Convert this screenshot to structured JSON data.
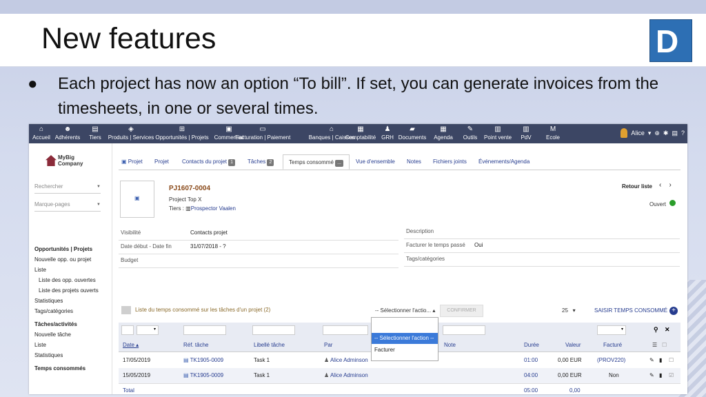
{
  "slide": {
    "title": "New features",
    "logo_letter": "D",
    "bullet_symbol": "●",
    "bullet_text": "Each project has now an option “To bill”. If set, you can generate invoices from the timesheets, in one or several times."
  },
  "nav": {
    "items": [
      {
        "label": "Accueil",
        "icon": "home-icon",
        "glyph": "⌂"
      },
      {
        "label": "Adhérents",
        "icon": "members-icon",
        "glyph": "☻"
      },
      {
        "label": "Tiers",
        "icon": "building-icon",
        "glyph": "▤"
      },
      {
        "label": "Produits | Services",
        "icon": "cube-icon",
        "glyph": "◈"
      },
      {
        "label": "Opportunités | Projets",
        "icon": "sitemap-icon",
        "glyph": "⊞"
      },
      {
        "label": "Commercial",
        "icon": "briefcase-icon",
        "glyph": "▣"
      },
      {
        "label": "Facturation | Paiement",
        "icon": "money-icon",
        "glyph": "▭"
      },
      {
        "label": "Banques | Caisses",
        "icon": "bank-icon",
        "glyph": "⌂"
      },
      {
        "label": "Comptabilité",
        "icon": "ledger-icon",
        "glyph": "▦"
      },
      {
        "label": "GRH",
        "icon": "user-icon",
        "glyph": "♟"
      },
      {
        "label": "Documents",
        "icon": "folder-icon",
        "glyph": "▰"
      },
      {
        "label": "Agenda",
        "icon": "calendar-icon",
        "glyph": "▦"
      },
      {
        "label": "Outils",
        "icon": "wrench-icon",
        "glyph": "✎"
      },
      {
        "label": "Point vente",
        "icon": "cash-register-icon",
        "glyph": "▥"
      },
      {
        "label": "PdV",
        "icon": "pos-icon",
        "glyph": "▥"
      },
      {
        "label": "Ecole",
        "icon": "school-icon",
        "glyph": "M"
      }
    ],
    "user_name": "Alice",
    "right_icons": [
      "globe-icon",
      "bug-icon",
      "print-icon",
      "help-icon"
    ]
  },
  "sidebar": {
    "company_line1": "MyBig",
    "company_line2": "Company",
    "search_placeholder": "Rechercher",
    "bookmarks_placeholder": "Marque-pages",
    "menu": [
      {
        "label": "Opportunités | Projets",
        "type": "h"
      },
      {
        "label": "Nouvelle opp. ou projet",
        "type": "m"
      },
      {
        "label": "Liste",
        "type": "m"
      },
      {
        "label": "Liste des opp. ouvertes",
        "type": "sub"
      },
      {
        "label": "Liste des projets ouverts",
        "type": "sub"
      },
      {
        "label": "Statistiques",
        "type": "m"
      },
      {
        "label": "Tags/catégories",
        "type": "m"
      },
      {
        "label": "Tâches/activités",
        "type": "h"
      },
      {
        "label": "Nouvelle tâche",
        "type": "m"
      },
      {
        "label": "Liste",
        "type": "m"
      },
      {
        "label": "Statistiques",
        "type": "m"
      },
      {
        "label": "Temps consommés",
        "type": "h"
      }
    ]
  },
  "tabs": [
    {
      "label": "Projet",
      "icon": true
    },
    {
      "label": "Projet"
    },
    {
      "label": "Contacts du projet",
      "badge": "1"
    },
    {
      "label": "Tâches",
      "badge": "2"
    },
    {
      "label": "Temps consommé",
      "badge": "...",
      "active": true
    },
    {
      "label": "Vue d'ensemble"
    },
    {
      "label": "Notes"
    },
    {
      "label": "Fichiers joints"
    },
    {
      "label": "Événements/Agenda"
    }
  ],
  "project": {
    "ref": "PJ1607-0004",
    "label": "Project Top X",
    "tiers_label": "Tiers :",
    "tiers_name": "Prospector Vaalen",
    "back_to_list": "Retour liste",
    "prev": "‹",
    "next": "›",
    "status": "Ouvert",
    "status_color": "#2a9d2a"
  },
  "fields": {
    "left": [
      {
        "label": "Visibilité",
        "value": "Contacts projet"
      },
      {
        "label": "Date début - Date fin",
        "value": "31/07/2018 - ?"
      },
      {
        "label": "Budget",
        "value": ""
      }
    ],
    "right": [
      {
        "label": "Description",
        "value": ""
      },
      {
        "label": "Facturer le temps passé",
        "value": "Oui"
      },
      {
        "label": "Tags/catégories",
        "value": ""
      }
    ]
  },
  "list": {
    "title": "Liste du temps consommé sur les tâches d'un projet (2)",
    "action_select": "-- Sélectionner l'actio...",
    "action_arrow": "▴",
    "confirm": "CONFIRMER",
    "page_size": "25",
    "page_arrow": "▾",
    "add_label": "SAISIR TEMPS CONSOMMÉ",
    "add_icon": "+",
    "dropdown": {
      "selected": "-- Sélectionner l'action --",
      "options": [
        "Facturer"
      ]
    },
    "filter_arrow": "▾",
    "search_glyph": "⚲",
    "clear_glyph": "✕",
    "columns": [
      "Date ▴",
      "Réf. tâche",
      "Libellé tâche",
      "Par",
      "Note",
      "Durée",
      "Valeur",
      "Facturé"
    ],
    "rows": [
      {
        "date": "17/05/2019",
        "ref": "TK1905-0009",
        "label": "Task 1",
        "by": "Alice Adminson",
        "duree": "01:00",
        "valeur": "0,00 EUR",
        "facture": "(PROV220)",
        "checked": false
      },
      {
        "date": "15/05/2019",
        "ref": "TK1905-0009",
        "label": "Task 1",
        "by": "Alice Adminson",
        "duree": "04:00",
        "valeur": "0,00 EUR",
        "facture": "Non",
        "checked": true
      }
    ],
    "total_label": "Total",
    "total_duree": "05:00",
    "total_valeur": "0,00"
  }
}
